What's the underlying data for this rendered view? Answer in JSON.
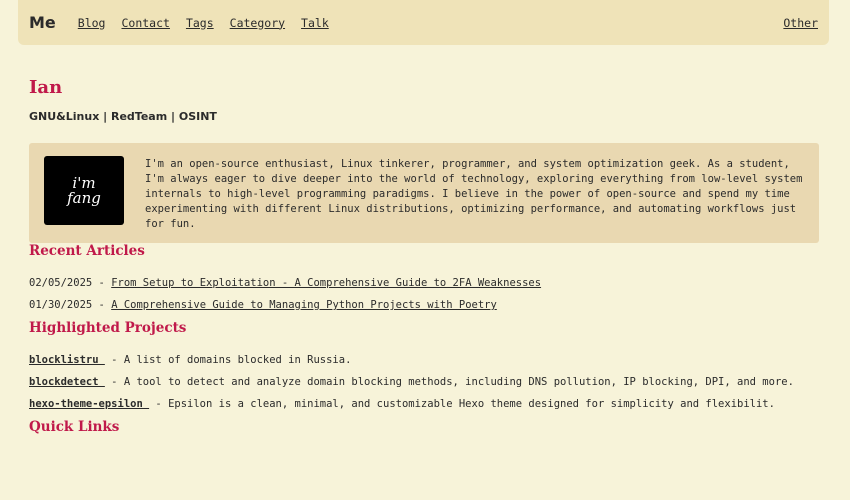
{
  "nav": {
    "brand": "Me",
    "links": [
      "Blog",
      "Contact",
      "Tags",
      "Category",
      "Talk"
    ],
    "right_link": "Other"
  },
  "profile": {
    "name": "Ian",
    "tagline": "GNU&Linux | RedTeam | OSINT",
    "avatar_text": "i'm fang",
    "bio": "I'm an open-source enthusiast, Linux tinkerer, programmer, and system optimization geek. As a student, I'm always eager to dive deeper into the world of technology, exploring everything from low-level system internals to high-level programming paradigms. I believe in the power of open-source and spend my time experimenting with different Linux distributions, optimizing performance, and automating workflows just for fun."
  },
  "recent": {
    "heading": "Recent Articles",
    "articles": [
      {
        "date": "02/05/2025",
        "sep": " - ",
        "title": "From Setup to Exploitation - A Comprehensive Guide to 2FA Weaknesses"
      },
      {
        "date": "01/30/2025",
        "sep": " - ",
        "title": "A Comprehensive Guide to Managing Python Projects with Poetry"
      }
    ]
  },
  "projects": {
    "heading": "Highlighted Projects",
    "items": [
      {
        "name": "blocklistru ",
        "desc": " - A list of domains blocked in Russia."
      },
      {
        "name": "blockdetect ",
        "desc": " - A tool to detect and analyze domain blocking methods, including DNS pollution, IP blocking, DPI, and more."
      },
      {
        "name": "hexo-theme-epsilon ",
        "desc": " - Epsilon is a clean, minimal, and customizable Hexo theme designed for simplicity and flexibilit."
      }
    ]
  },
  "quick": {
    "heading": "Quick Links"
  },
  "colors": {
    "accent": "#c0194a",
    "background": "#f7f3d9",
    "navbar": "#efe3b8",
    "bio_box": "#e9d8b1"
  }
}
